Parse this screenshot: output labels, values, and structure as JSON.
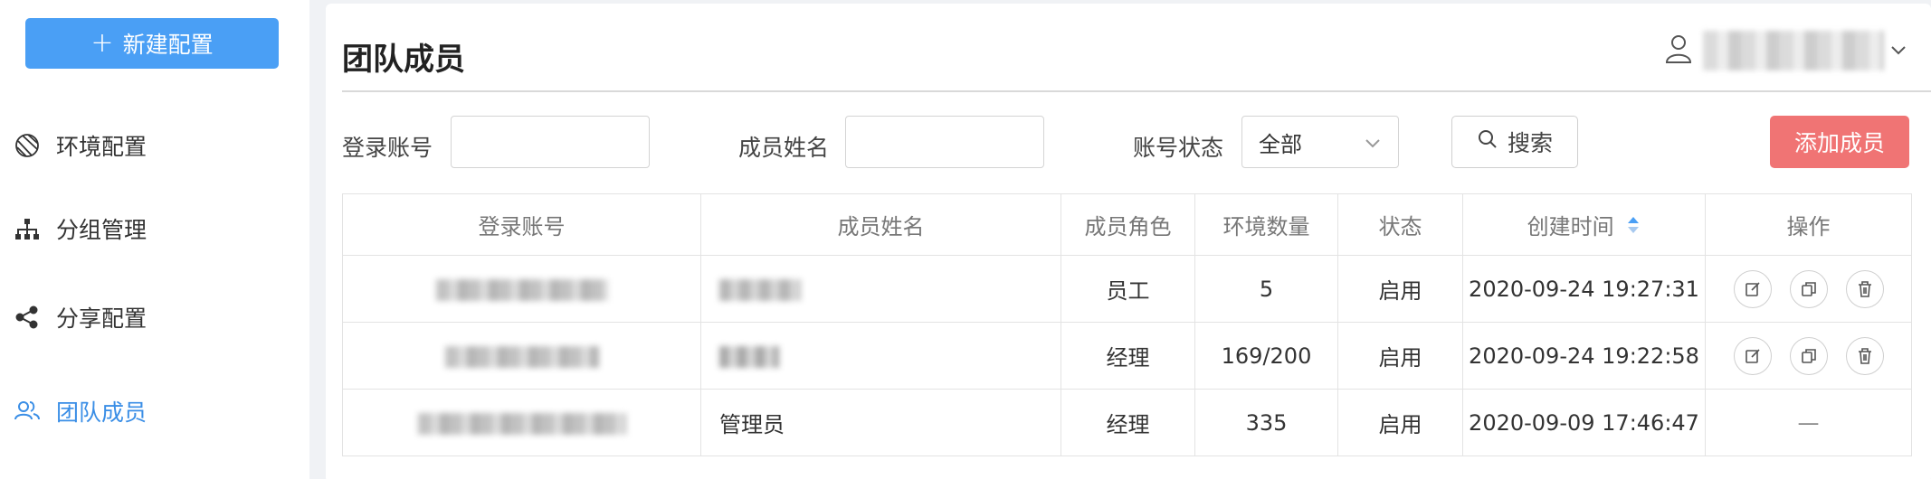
{
  "sidebar": {
    "new_config_label": "新建配置",
    "items": [
      {
        "label": "环境配置",
        "icon": "globe-icon",
        "active": false
      },
      {
        "label": "分组管理",
        "icon": "org-chart-icon",
        "active": false
      },
      {
        "label": "分享配置",
        "icon": "share-icon",
        "active": false
      },
      {
        "label": "团队成员",
        "icon": "team-icon",
        "active": true
      }
    ]
  },
  "header": {
    "title": "团队成员",
    "user_icon": "user-icon"
  },
  "filters": {
    "account_label": "登录账号",
    "account_value": "",
    "name_label": "成员姓名",
    "name_value": "",
    "status_label": "账号状态",
    "status_selected": "全部",
    "search_label": "搜索",
    "add_label": "添加成员"
  },
  "table": {
    "columns": [
      "登录账号",
      "成员姓名",
      "成员角色",
      "环境数量",
      "状态",
      "创建时间",
      "操作"
    ],
    "rows": [
      {
        "name": "",
        "role": "员工",
        "env_count": "5",
        "status": "启用",
        "created": "2020-09-24 19:27:31"
      },
      {
        "name": "",
        "role": "经理",
        "env_count": "169/200",
        "status": "启用",
        "created": "2020-09-24 19:22:58"
      },
      {
        "name": "管理员",
        "role": "经理",
        "env_count": "335",
        "status": "启用",
        "created": "2020-09-09 17:46:47",
        "ops_text": "—"
      }
    ]
  },
  "colors": {
    "primary": "#4a9ff5",
    "active_nav": "#3a8ee6",
    "danger_button": "#f07474"
  }
}
